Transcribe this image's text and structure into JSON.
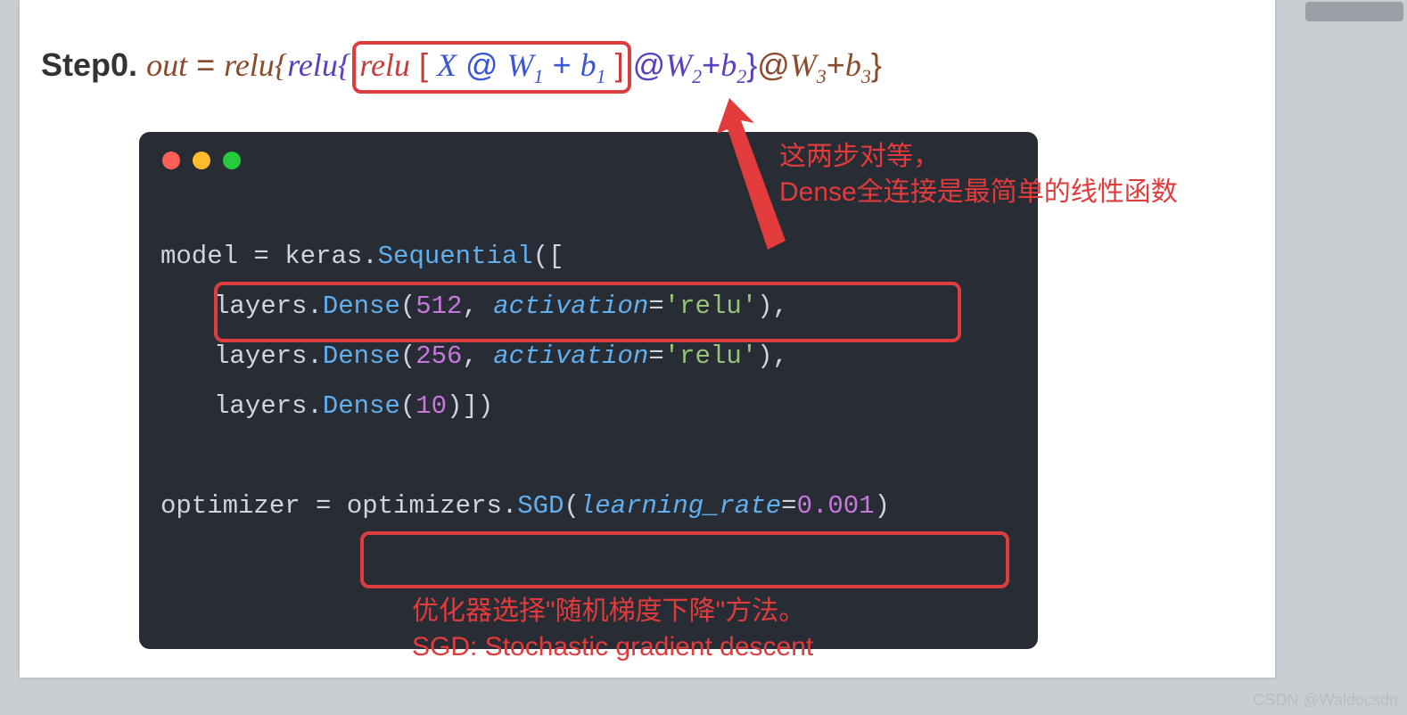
{
  "formula": {
    "step_label": "Step0.",
    "out": "out",
    "eq": "=",
    "relu1": "relu{",
    "relu2": "relu{",
    "relu3": "relu",
    "inner_open": "[",
    "X": "X",
    "at1": "@",
    "W1": "W",
    "W1_sub": "1",
    "plus1": " + ",
    "b1": "b",
    "b1_sub": "1",
    "inner_close": "]",
    "at2": "@",
    "W2": "W",
    "W2_sub": "2",
    "plus2": " + ",
    "b2": "b",
    "b2_sub": "2",
    "close2": "}",
    "at3": "@",
    "W3": "W",
    "W3_sub": "3",
    "plus3": " + ",
    "b3": "b",
    "b3_sub": "3",
    "close1": "}"
  },
  "code": {
    "l1": {
      "a": "model ",
      "b": "= ",
      "c": "keras",
      "d": ".",
      "e": "Sequential",
      "f": "(["
    },
    "l2": {
      "a": "layers",
      "b": ".",
      "c": "Dense",
      "d": "(",
      "n": "512",
      "e": ", ",
      "f": "activation",
      "g": "=",
      "s": "'relu'",
      "h": "),"
    },
    "l3": {
      "a": "layers",
      "b": ".",
      "c": "Dense",
      "d": "(",
      "n": "256",
      "e": ", ",
      "f": "activation",
      "g": "=",
      "s": "'relu'",
      "h": "),"
    },
    "l4": {
      "a": "layers",
      "b": ".",
      "c": "Dense",
      "d": "(",
      "n": "10",
      "h": ")])"
    },
    "l6": {
      "a": "optimizer ",
      "b": "= ",
      "c": "optimizers",
      "d": ".",
      "e": "SGD",
      "f": "(",
      "g": "learning_rate",
      "h": "=",
      "n": "0.001",
      "i": ")"
    }
  },
  "annotations": {
    "top_line1": "这两步对等，",
    "top_line2": "Dense全连接是最简单的线性函数",
    "bottom_line1": "优化器选择\"随机梯度下降\"方法。",
    "bottom_line2": "SGD: Stochastic gradient descent"
  },
  "watermark": "CSDN @Waldocsdn"
}
